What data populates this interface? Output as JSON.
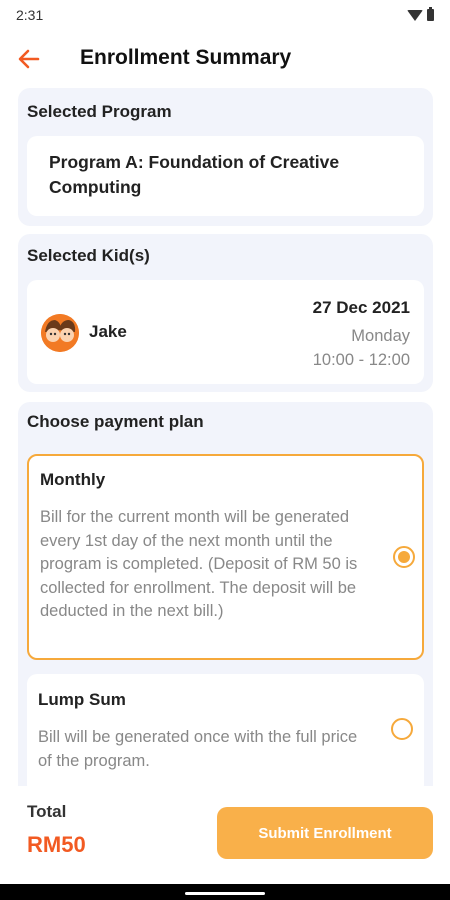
{
  "status_bar": {
    "time": "2:31"
  },
  "header": {
    "title": "Enrollment Summary"
  },
  "program_section": {
    "title": "Selected Program",
    "program_name": "Program A: Foundation of Creative Computing"
  },
  "kids_section": {
    "title": "Selected Kid(s)",
    "kid": {
      "name": "Jake",
      "date": "27 Dec 2021",
      "day": "Monday",
      "time": "10:00 - 12:00"
    }
  },
  "payment_section": {
    "title": "Choose payment plan",
    "plans": [
      {
        "name": "Monthly",
        "description": "Bill for the current month will be generated every 1st day of the next month until the program is completed. (Deposit of RM 50 is collected for enrollment. The deposit will be deducted in the next bill.)",
        "selected": true
      },
      {
        "name": "Lump Sum",
        "description": "Bill will be generated once with the full price of the program.",
        "selected": false
      }
    ]
  },
  "footer": {
    "total_label": "Total",
    "total_value": "RM50",
    "submit_label": "Submit Enrollment"
  },
  "colors": {
    "accent": "#f6a93b",
    "total": "#f25a22",
    "back_arrow": "#f25a22",
    "panel_bg": "#f2f4fb"
  },
  "icons": {
    "back": "arrow-left-icon",
    "wifi": "wifi-icon",
    "battery": "battery-icon",
    "radio": "radio-button-icon"
  }
}
